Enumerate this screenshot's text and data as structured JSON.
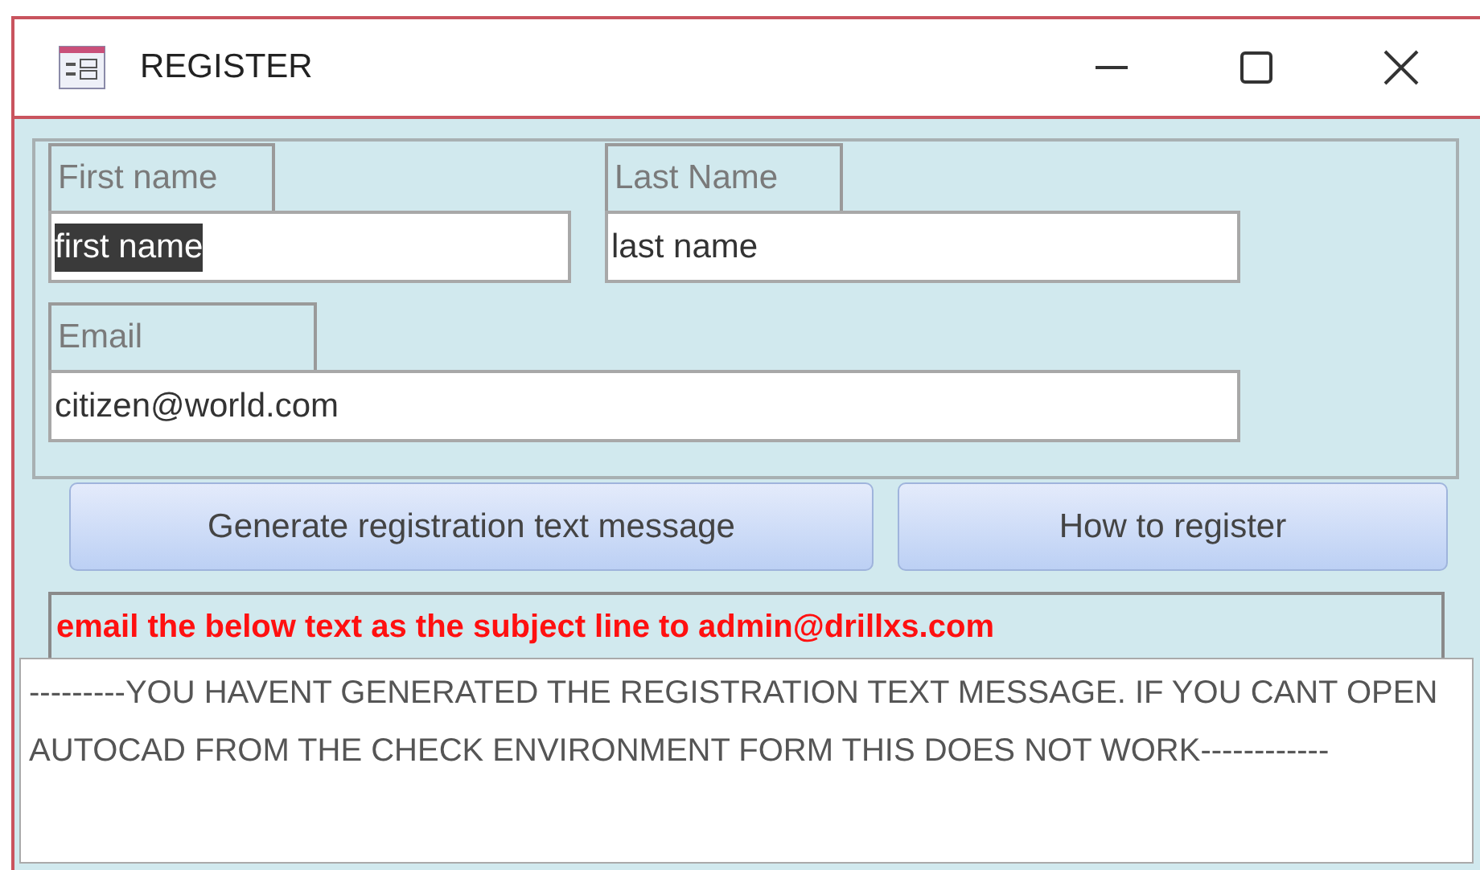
{
  "window": {
    "title": "REGISTER"
  },
  "fields": [
    {
      "label": "First name",
      "value": "first name",
      "highlighted": true
    },
    {
      "label": "Last Name",
      "value": "last name",
      "highlighted": false
    },
    {
      "label": "Email",
      "value": "citizen@world.com",
      "highlighted": false
    }
  ],
  "buttons": [
    "Generate registration text message",
    "How to register"
  ],
  "instruction": "email the below text as the subject line to admin@drillxs.com",
  "message": "---------YOU HAVENT GENERATED THE REGISTRATION TEXT MESSAGE. IF YOU CANT OPEN AUTOCAD FROM THE CHECK ENVIRONMENT FORM THIS DOES NOT WORK------------"
}
